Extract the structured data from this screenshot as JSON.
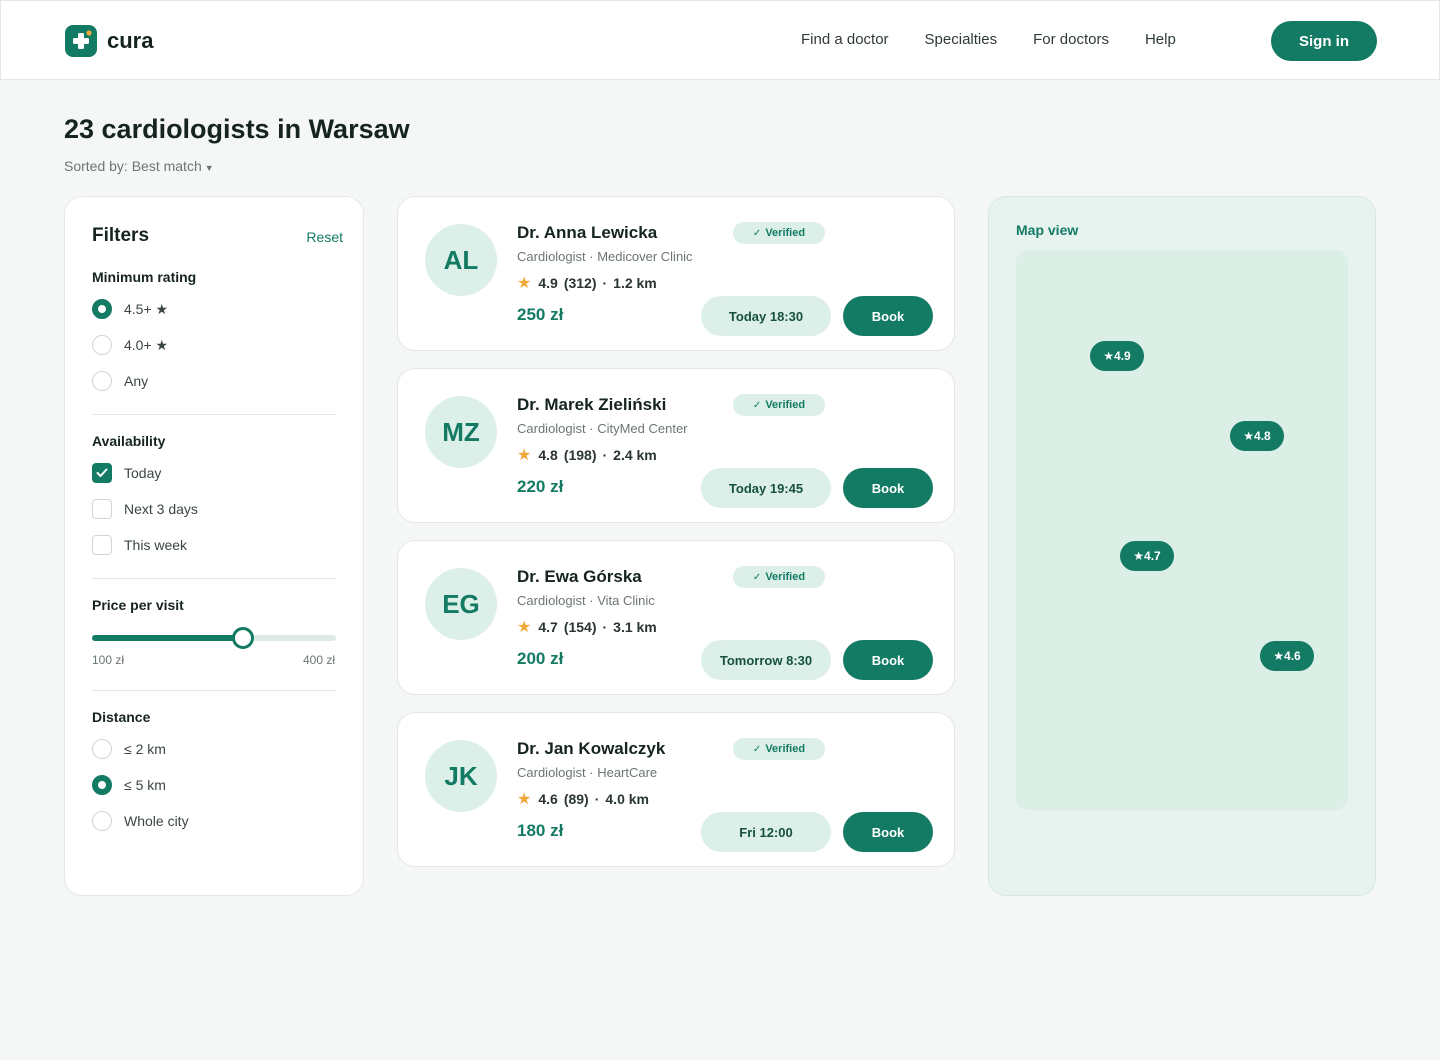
{
  "header": {
    "logo_text": "cura",
    "nav": [
      "Find a doctor",
      "Specialties",
      "For doctors",
      "Help"
    ],
    "signin_label": "Sign in"
  },
  "page": {
    "title": "23 cardiologists in Warsaw",
    "sorted_by": "Sorted by: Best match"
  },
  "filters": {
    "title": "Filters",
    "reset": "Reset",
    "rating": {
      "title": "Minimum rating",
      "options": [
        "4.5+ ★",
        "4.0+ ★",
        "Any"
      ],
      "selected_index": 0
    },
    "availability": {
      "title": "Availability",
      "options": [
        "Today",
        "Next 3 days",
        "This week"
      ],
      "checked": [
        true,
        false,
        false
      ]
    },
    "price": {
      "title": "Price per visit",
      "min_label": "100 zł",
      "max_label": "400 zł",
      "level_fraction": 0.62
    },
    "distance": {
      "title": "Distance",
      "options": [
        "≤ 2 km",
        "≤ 5 km",
        "Whole city"
      ],
      "selected_index": 1
    }
  },
  "doctors": [
    {
      "initials": "AL",
      "name": "Dr. Anna Lewicka",
      "badge": "Verified",
      "specialty": "Cardiologist · Medicover Clinic",
      "rating": "4.9",
      "reviews": "(312)",
      "distance": "1.2 km",
      "price": "250 zł",
      "slot": "Today 18:30",
      "book": "Book"
    },
    {
      "initials": "MZ",
      "name": "Dr. Marek Zieliński",
      "badge": "Verified",
      "specialty": "Cardiologist · CityMed Center",
      "rating": "4.8",
      "reviews": "(198)",
      "distance": "2.4 km",
      "price": "220 zł",
      "slot": "Today 19:45",
      "book": "Book"
    },
    {
      "initials": "EG",
      "name": "Dr. Ewa Górska",
      "badge": "Verified",
      "specialty": "Cardiologist · Vita Clinic",
      "rating": "4.7",
      "reviews": "(154)",
      "distance": "3.1 km",
      "price": "200 zł",
      "slot": "Tomorrow 8:30",
      "book": "Book"
    },
    {
      "initials": "JK",
      "name": "Dr. Jan Kowalczyk",
      "badge": "Verified",
      "specialty": "Cardiologist · HeartCare",
      "rating": "4.6",
      "reviews": "(89)",
      "distance": "4.0 km",
      "price": "180 zł",
      "slot": "Fri 12:00",
      "book": "Book"
    }
  ],
  "map": {
    "title": "Map view",
    "pins": [
      "★4.9",
      "★4.8",
      "★4.7",
      "★4.6"
    ]
  },
  "colors": {
    "accent": "#137a63",
    "accent_soft": "#dcefe8",
    "star": "#f0a73a",
    "background": "#f5f7f6"
  }
}
